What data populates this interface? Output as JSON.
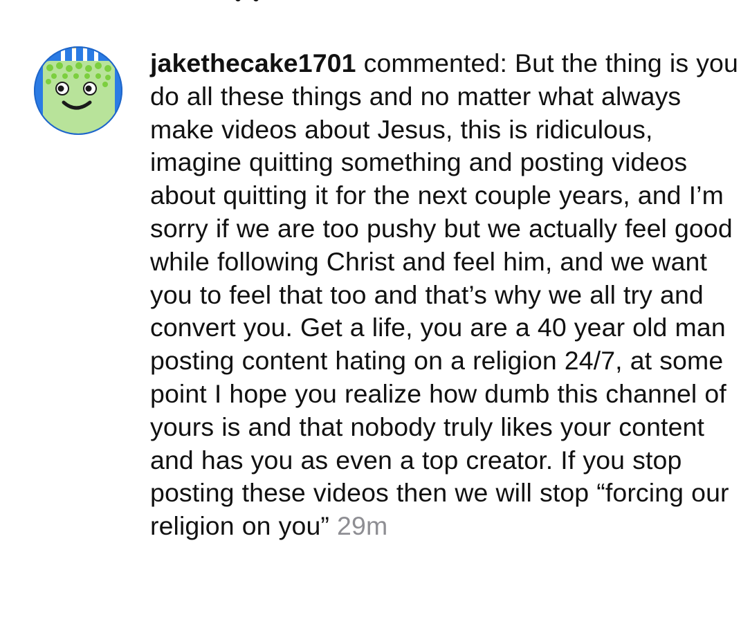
{
  "comment": {
    "avatar_icon": "cake-face-avatar-icon",
    "username": "jakethecake1701",
    "action": "commented:",
    "body": "But the thing is you do all these things and no matter what always make videos about Jesus, this is ridiculous, imagine quitting something and posting videos about quitting it for the next couple years, and I’m sorry if we are too pushy but we actually feel good while following Christ and feel him, and we want you to feel that too and that’s why we all try and convert you. Get a life, you are a 40 year old man posting content hating on a religion 24/7, at some point I hope you realize how dumb this channel of yours is and that nobody truly likes your content and has you as even a top creator. If you stop posting these videos then we will stop “forcing our religion on you”",
    "timestamp": "29m"
  },
  "colors": {
    "avatar_ring": "#2b7be4",
    "avatar_cake": "#b8e39a",
    "avatar_frosting": "#7ccf3f",
    "timestamp": "#8e8e93",
    "text": "#111111"
  }
}
